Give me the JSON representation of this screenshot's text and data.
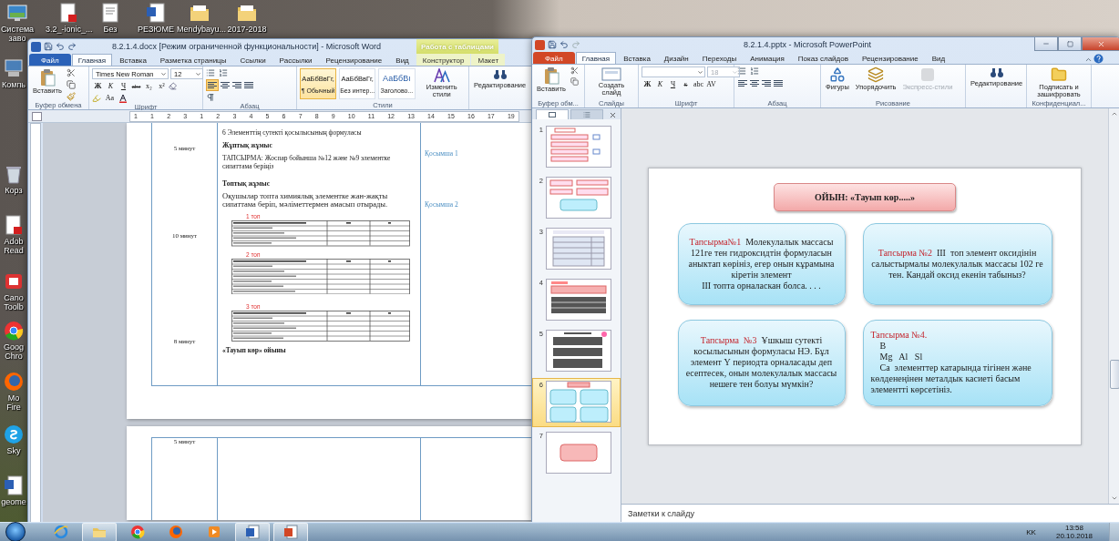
{
  "desktop": {
    "top_icons": [
      {
        "label": "Система заво",
        "kind": "screen"
      },
      {
        "label": "3.2_-ionic_...",
        "kind": "pdf"
      },
      {
        "label": "Без",
        "kind": "doc"
      },
      {
        "label": "РЕЗЮМЕ",
        "kind": "word"
      },
      {
        "label": "Mendybayu...",
        "kind": "folder"
      },
      {
        "label": "2017-2018",
        "kind": "folder"
      }
    ],
    "left_icons": [
      {
        "label": "Компь",
        "kind": "computer"
      },
      {
        "label": "Корз",
        "kind": "bin"
      },
      {
        "label": "Adob Read",
        "kind": "pdf"
      },
      {
        "label": "Cano Toolb",
        "kind": "app"
      },
      {
        "label": "Goog Chro",
        "kind": "chrome"
      },
      {
        "label": "Mo Fire",
        "kind": "firefox"
      },
      {
        "label": "Sky",
        "kind": "skype"
      },
      {
        "label": "geome",
        "kind": "word"
      }
    ]
  },
  "word": {
    "title": "8.2.1.4.docx [Режим ограниченной функциональности]  -  Microsoft Word",
    "context_header": "Работа с таблицами",
    "tabs": [
      {
        "label": "Файл",
        "kind": "file",
        "selected": false
      },
      {
        "label": "Главная",
        "kind": "normal",
        "selected": true
      },
      {
        "label": "Вставка",
        "kind": "normal",
        "selected": false
      },
      {
        "label": "Разметка страницы",
        "kind": "normal",
        "selected": false
      },
      {
        "label": "Ссылки",
        "kind": "normal",
        "selected": false
      },
      {
        "label": "Рассылки",
        "kind": "normal",
        "selected": false
      },
      {
        "label": "Рецензирование",
        "kind": "normal",
        "selected": false
      },
      {
        "label": "Вид",
        "kind": "normal",
        "selected": false
      },
      {
        "label": "Конструктор",
        "kind": "context",
        "selected": false
      },
      {
        "label": "Макет",
        "kind": "context",
        "selected": false
      }
    ],
    "ribbon": {
      "paste": "Вставить",
      "font_name": "Times New Roman",
      "font_size": "12",
      "format_buttons": [
        "Ж",
        "К",
        "Ч",
        "abc",
        "x₂",
        "x²"
      ],
      "case_button": "Aa",
      "alignment": [
        {
          "kind": "left",
          "selected": true
        },
        {
          "kind": "center",
          "selected": false
        },
        {
          "kind": "right",
          "selected": false
        },
        {
          "kind": "justify",
          "selected": false
        }
      ],
      "styles": [
        {
          "sample": "АаБбВвГг,",
          "name": "¶ Обычный",
          "selected": true
        },
        {
          "sample": "АаБбВвГг,",
          "name": "Без интер...",
          "selected": false
        },
        {
          "sample": "АаБбВı",
          "name": "Заголово...",
          "selected": false
        }
      ],
      "change_styles": "Изменить стили",
      "editing": "Редактирование",
      "group_labels": [
        "Буфер обмена",
        "Шрифт",
        "Абзац",
        "Стили"
      ]
    },
    "ruler": [
      "1",
      "1",
      "2",
      "3",
      "1",
      "2",
      "3",
      "4",
      "5",
      "6",
      "7",
      "8",
      "9",
      "10",
      "11",
      "12",
      "13",
      "14",
      "15",
      "16",
      "17",
      "19"
    ],
    "pages": [
      {
        "rows": [
          {
            "time": "5 минут",
            "appendix": "Қосымша 1",
            "content": [
              {
                "kind": "plain",
                "text": "6 Элементтің сутекті қосылысының формуласы"
              },
              {
                "kind": "bold",
                "text": "Жұптық жұмыс"
              },
              {
                "kind": "plain",
                "text": "ТАПСЫРМА:  Жоспар бойынша №12 және №9 элементке сипаттама беріңіз"
              }
            ]
          },
          {
            "time": "10 минут",
            "appendix": "Қосымша 2",
            "content": [
              {
                "kind": "bold",
                "text": "Топтық жұмыс"
              },
              {
                "kind": "large",
                "text": "Оқушылар топта химиялық элементке жан-жақты сипаттама беріп, мәліметтермен амасып отырады."
              },
              {
                "kind": "mini_table",
                "group": "1 топ"
              },
              {
                "kind": "mini_table",
                "group": "2 топ"
              }
            ]
          },
          {
            "time": "8 минут",
            "content": [
              {
                "kind": "mini_table",
                "group": "3 топ"
              },
              {
                "kind": "bold",
                "text": "«Тауып көр» ойыны"
              }
            ]
          }
        ]
      },
      {
        "rows": [
          {
            "time": "5 минут"
          }
        ]
      }
    ]
  },
  "powerpoint": {
    "title": "8.2.1.4.pptx - Microsoft PowerPoint",
    "tabs": [
      {
        "label": "Файл",
        "kind": "file",
        "selected": false
      },
      {
        "label": "Главная",
        "kind": "normal",
        "selected": true
      },
      {
        "label": "Вставка",
        "kind": "normal",
        "selected": false
      },
      {
        "label": "Дизайн",
        "kind": "normal",
        "selected": false
      },
      {
        "label": "Переходы",
        "kind": "normal",
        "selected": false
      },
      {
        "label": "Анимация",
        "kind": "normal",
        "selected": false
      },
      {
        "label": "Показ слайдов",
        "kind": "normal",
        "selected": false
      },
      {
        "label": "Рецензирование",
        "kind": "normal",
        "selected": false
      },
      {
        "label": "Вид",
        "kind": "normal",
        "selected": false
      }
    ],
    "ribbon": {
      "paste": "Вставить",
      "new_slide": "Создать слайд",
      "font_size": "18",
      "font_disabled": true,
      "format_buttons": [
        "Ж",
        "К",
        "Ч",
        "S",
        "abc",
        "AV"
      ],
      "drawing_buttons": [
        {
          "label": "Фигуры",
          "disabled": false
        },
        {
          "label": "Упорядочить",
          "disabled": false
        },
        {
          "label": "Экспресс-стили",
          "disabled": true
        }
      ],
      "editing": "Редактирование",
      "sign": "Подписать и зашифровать",
      "group_labels": [
        "Буфер обм...",
        "Слайды",
        "Шрифт",
        "Абзац",
        "Рисование",
        "Конфиденциал..."
      ]
    },
    "slides": [
      {
        "number": "1",
        "kind": "list",
        "selected": false
      },
      {
        "number": "2",
        "kind": "boxes",
        "selected": false
      },
      {
        "number": "3",
        "kind": "table",
        "selected": false
      },
      {
        "number": "4",
        "kind": "banner",
        "selected": false
      },
      {
        "number": "5",
        "kind": "tables",
        "selected": false
      },
      {
        "number": "6",
        "kind": "game",
        "selected": true
      },
      {
        "number": "7",
        "kind": "end",
        "selected": false
      }
    ],
    "slide": {
      "title": "ОЙЫН: «Тауып көр.....»",
      "cards": [
        {
          "kind": "inline",
          "label": "Тапсырма№1",
          "lines": [
            "Молекулалык массасы 121ге тен гидроксидтін формуласын аныктап көрініз, егер онын кұрамына кіретін элемент",
            "ІІІ топта орналаскан болса. . . ."
          ]
        },
        {
          "kind": "inline",
          "label": "Тапсырма №2",
          "lines": [
            "ІІІ  топ элемент оксидінін салыстырмалы молекулалык массасы 102 ге тен. Кандай оксид екенін табыныз?"
          ]
        },
        {
          "kind": "inline",
          "label": "Тапсырма  №3",
          "lines": [
            "Ұшкыш сутекті косылысынын формуласы НЭ. Бұл элемент Ү периодта орналасады деп есептесек, онын молекулалык массасы нешеге тен болуы мүмкін?"
          ]
        },
        {
          "kind": "list",
          "label": "Тапсырма №4.",
          "lines": [
            "В",
            "Mg   Al   Sl",
            "Са  элементтер катарында тігінен және көлденеңінен металдык касиеті басым элементті көрсетініз."
          ]
        }
      ]
    },
    "notes": {
      "placeholder": "Заметки к слайду"
    }
  },
  "taskbar": {
    "apps": [
      {
        "kind": "ie",
        "running": false
      },
      {
        "kind": "explorer",
        "running": true
      },
      {
        "kind": "chrome",
        "running": false
      },
      {
        "kind": "firefox",
        "running": false
      },
      {
        "kind": "media",
        "running": false
      },
      {
        "kind": "word",
        "running": true
      },
      {
        "kind": "powerpoint",
        "running": true
      }
    ],
    "tray": {
      "language": "KK",
      "time": "13:58",
      "date": "20.10.2018"
    }
  }
}
